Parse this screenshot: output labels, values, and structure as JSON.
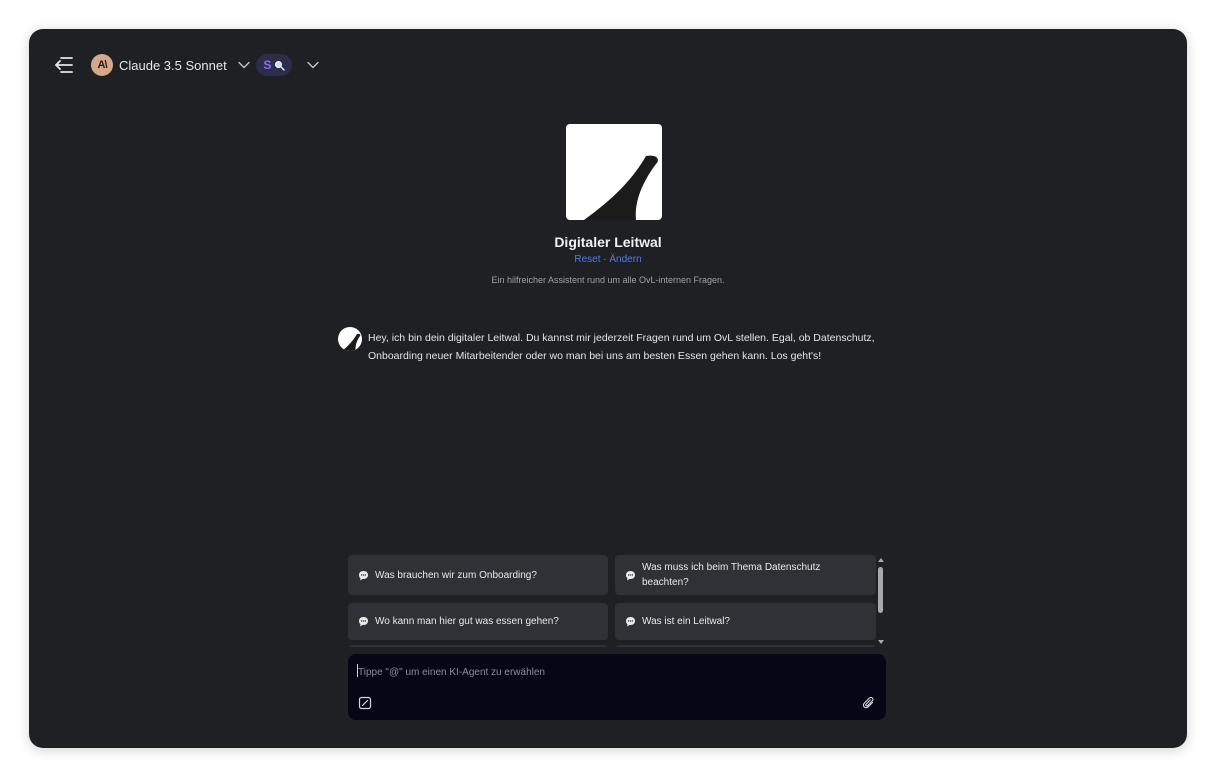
{
  "header": {
    "model_avatar_text": "A\\",
    "model_name": "Claude 3.5 Sonnet",
    "agent_badge_letter": "S"
  },
  "agent": {
    "name": "Digitaler Leitwal",
    "reset_label": "Reset",
    "separator": " · ",
    "change_label": "Ändern",
    "description": "Ein hilfreicher Assistent rund um alle OvL-internen Fragen."
  },
  "greeting": {
    "text": "Hey, ich bin dein digitaler Leitwal. Du kannst mir jederzeit Fragen rund um OvL stellen. Egal, ob Datenschutz, Onboarding neuer Mitarbeitender oder wo man bei uns am besten Essen gehen kann. Los geht's!"
  },
  "suggestions": [
    {
      "text": "Was brauchen wir zum Onboarding?"
    },
    {
      "text": "Was muss ich beim Thema Datenschutz beachten?"
    },
    {
      "text": "Wo kann man hier gut was essen gehen?"
    },
    {
      "text": "Was ist ein Leitwal?"
    }
  ],
  "composer": {
    "placeholder": "Tippe \"@\" um einen KI-Agent zu erwählen"
  },
  "colors": {
    "background": "#1f2024",
    "link": "#4f7df0",
    "agent_accent": "#8f6cf0",
    "model_avatar": "#d6a88a"
  },
  "icons": [
    "sidebar-collapse-icon",
    "chevron-down-icon",
    "search-icon",
    "chat-bubble-icon",
    "new-chat-icon",
    "paperclip-icon"
  ]
}
